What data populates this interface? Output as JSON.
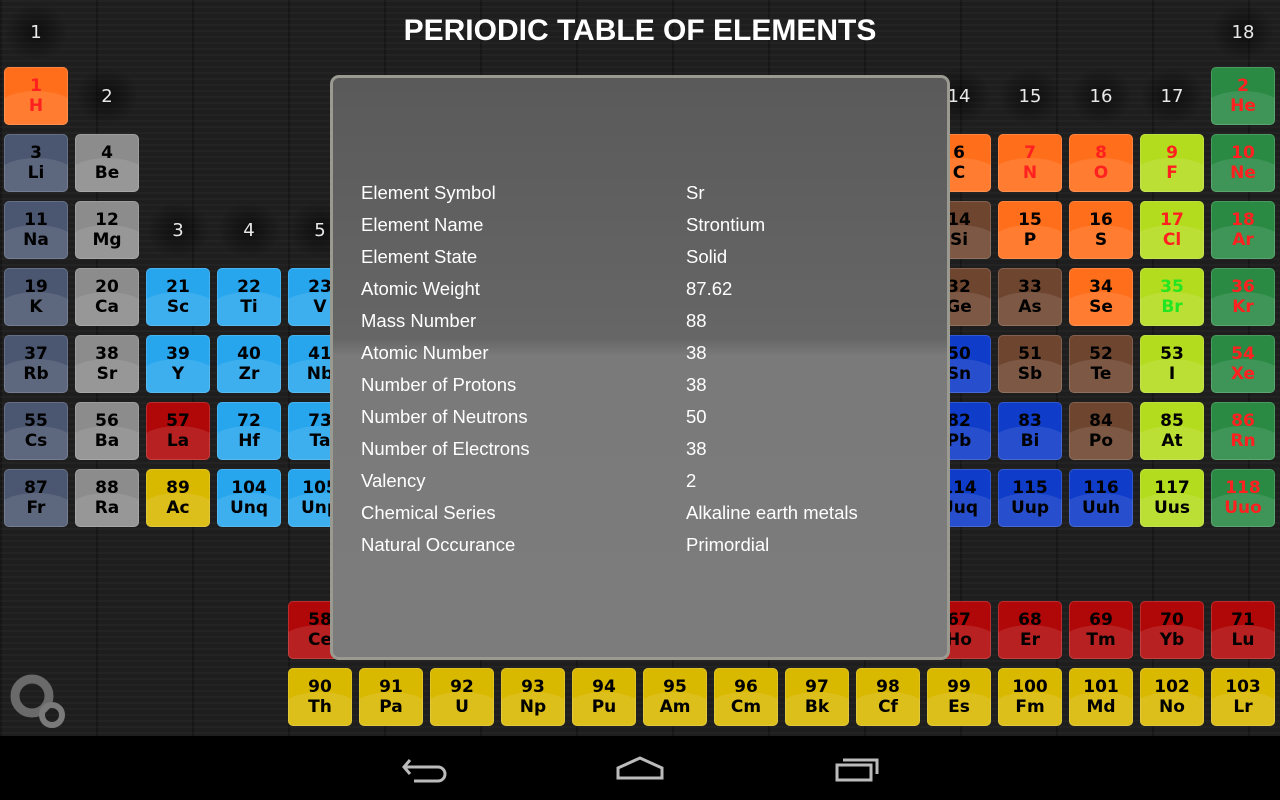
{
  "title": "PERIODIC TABLE OF ELEMENTS",
  "colors": {
    "hydrogen": "#ff6e1a",
    "alkali": "#4b5670",
    "alkaline": "#8c8c8c",
    "transition": "#27a6ee",
    "lanthanide": "#b00808",
    "actinide": "#d9b800",
    "nonmetal": "#ff6e1a",
    "halogen": "#b4dc1e",
    "noble": "#2a8a44",
    "metalloid": "#6e4630",
    "poor": "#0f3cc8",
    "text_solid": "#000000",
    "text_gas": "#ff2020",
    "text_liquid": "#22e622"
  },
  "group_labels": {
    "top": [
      {
        "label": "1",
        "col": 1
      },
      {
        "label": "18",
        "col": 18
      }
    ],
    "row1": [
      {
        "label": "2",
        "col": 2
      },
      {
        "label": "14",
        "col": 14
      },
      {
        "label": "15",
        "col": 15
      },
      {
        "label": "16",
        "col": 16
      },
      {
        "label": "17",
        "col": 17
      }
    ],
    "row3": [
      {
        "label": "3",
        "col": 3
      },
      {
        "label": "4",
        "col": 4
      },
      {
        "label": "5",
        "col": 5
      }
    ]
  },
  "periods": [
    [
      {
        "col": 1,
        "n": "1",
        "s": "H",
        "cat": "hydrogen",
        "st": "gas"
      },
      {
        "col": 18,
        "n": "2",
        "s": "He",
        "cat": "noble",
        "st": "gas"
      }
    ],
    [
      {
        "col": 1,
        "n": "3",
        "s": "Li",
        "cat": "alkali"
      },
      {
        "col": 2,
        "n": "4",
        "s": "Be",
        "cat": "alkaline"
      },
      {
        "col": 14,
        "n": "6",
        "s": "C",
        "cat": "nonmetal"
      },
      {
        "col": 15,
        "n": "7",
        "s": "N",
        "cat": "nonmetal",
        "st": "gas"
      },
      {
        "col": 16,
        "n": "8",
        "s": "O",
        "cat": "nonmetal",
        "st": "gas"
      },
      {
        "col": 17,
        "n": "9",
        "s": "F",
        "cat": "halogen",
        "st": "gas"
      },
      {
        "col": 18,
        "n": "10",
        "s": "Ne",
        "cat": "noble",
        "st": "gas"
      }
    ],
    [
      {
        "col": 1,
        "n": "11",
        "s": "Na",
        "cat": "alkali"
      },
      {
        "col": 2,
        "n": "12",
        "s": "Mg",
        "cat": "alkaline"
      },
      {
        "col": 14,
        "n": "14",
        "s": "Si",
        "cat": "metalloid"
      },
      {
        "col": 15,
        "n": "15",
        "s": "P",
        "cat": "nonmetal"
      },
      {
        "col": 16,
        "n": "16",
        "s": "S",
        "cat": "nonmetal"
      },
      {
        "col": 17,
        "n": "17",
        "s": "Cl",
        "cat": "halogen",
        "st": "gas"
      },
      {
        "col": 18,
        "n": "18",
        "s": "Ar",
        "cat": "noble",
        "st": "gas"
      }
    ],
    [
      {
        "col": 1,
        "n": "19",
        "s": "K",
        "cat": "alkali"
      },
      {
        "col": 2,
        "n": "20",
        "s": "Ca",
        "cat": "alkaline"
      },
      {
        "col": 3,
        "n": "21",
        "s": "Sc",
        "cat": "transition"
      },
      {
        "col": 4,
        "n": "22",
        "s": "Ti",
        "cat": "transition"
      },
      {
        "col": 5,
        "n": "23",
        "s": "V",
        "cat": "transition"
      },
      {
        "col": 14,
        "n": "32",
        "s": "Ge",
        "cat": "metalloid"
      },
      {
        "col": 15,
        "n": "33",
        "s": "As",
        "cat": "metalloid"
      },
      {
        "col": 16,
        "n": "34",
        "s": "Se",
        "cat": "nonmetal"
      },
      {
        "col": 17,
        "n": "35",
        "s": "Br",
        "cat": "halogen",
        "st": "liquid"
      },
      {
        "col": 18,
        "n": "36",
        "s": "Kr",
        "cat": "noble",
        "st": "gas"
      }
    ],
    [
      {
        "col": 1,
        "n": "37",
        "s": "Rb",
        "cat": "alkali"
      },
      {
        "col": 2,
        "n": "38",
        "s": "Sr",
        "cat": "alkaline"
      },
      {
        "col": 3,
        "n": "39",
        "s": "Y",
        "cat": "transition"
      },
      {
        "col": 4,
        "n": "40",
        "s": "Zr",
        "cat": "transition"
      },
      {
        "col": 5,
        "n": "41",
        "s": "Nb",
        "cat": "transition"
      },
      {
        "col": 14,
        "n": "50",
        "s": "Sn",
        "cat": "poor"
      },
      {
        "col": 15,
        "n": "51",
        "s": "Sb",
        "cat": "metalloid"
      },
      {
        "col": 16,
        "n": "52",
        "s": "Te",
        "cat": "metalloid"
      },
      {
        "col": 17,
        "n": "53",
        "s": "I",
        "cat": "halogen"
      },
      {
        "col": 18,
        "n": "54",
        "s": "Xe",
        "cat": "noble",
        "st": "gas"
      }
    ],
    [
      {
        "col": 1,
        "n": "55",
        "s": "Cs",
        "cat": "alkali"
      },
      {
        "col": 2,
        "n": "56",
        "s": "Ba",
        "cat": "alkaline"
      },
      {
        "col": 3,
        "n": "57",
        "s": "La",
        "cat": "lanthanide"
      },
      {
        "col": 4,
        "n": "72",
        "s": "Hf",
        "cat": "transition"
      },
      {
        "col": 5,
        "n": "73",
        "s": "Ta",
        "cat": "transition"
      },
      {
        "col": 14,
        "n": "82",
        "s": "Pb",
        "cat": "poor"
      },
      {
        "col": 15,
        "n": "83",
        "s": "Bi",
        "cat": "poor"
      },
      {
        "col": 16,
        "n": "84",
        "s": "Po",
        "cat": "metalloid"
      },
      {
        "col": 17,
        "n": "85",
        "s": "At",
        "cat": "halogen"
      },
      {
        "col": 18,
        "n": "86",
        "s": "Rn",
        "cat": "noble",
        "st": "gas"
      }
    ],
    [
      {
        "col": 1,
        "n": "87",
        "s": "Fr",
        "cat": "alkali"
      },
      {
        "col": 2,
        "n": "88",
        "s": "Ra",
        "cat": "alkaline"
      },
      {
        "col": 3,
        "n": "89",
        "s": "Ac",
        "cat": "actinide"
      },
      {
        "col": 4,
        "n": "104",
        "s": "Unq",
        "cat": "transition"
      },
      {
        "col": 5,
        "n": "105",
        "s": "Unp",
        "cat": "transition"
      },
      {
        "col": 14,
        "n": "114",
        "s": "Uuq",
        "cat": "poor"
      },
      {
        "col": 15,
        "n": "115",
        "s": "Uup",
        "cat": "poor"
      },
      {
        "col": 16,
        "n": "116",
        "s": "Uuh",
        "cat": "poor"
      },
      {
        "col": 17,
        "n": "117",
        "s": "Uus",
        "cat": "halogen"
      },
      {
        "col": 18,
        "n": "118",
        "s": "Uuo",
        "cat": "noble",
        "st": "gas"
      }
    ]
  ],
  "lanthanides": [
    {
      "col": 5,
      "n": "58",
      "s": "Ce"
    },
    {
      "col": 14,
      "n": "67",
      "s": "Ho"
    },
    {
      "col": 15,
      "n": "68",
      "s": "Er"
    },
    {
      "col": 16,
      "n": "69",
      "s": "Tm"
    },
    {
      "col": 17,
      "n": "70",
      "s": "Yb"
    },
    {
      "col": 18,
      "n": "71",
      "s": "Lu"
    }
  ],
  "actinides": [
    {
      "col": 5,
      "n": "90",
      "s": "Th"
    },
    {
      "col": 6,
      "n": "91",
      "s": "Pa"
    },
    {
      "col": 7,
      "n": "92",
      "s": "U"
    },
    {
      "col": 8,
      "n": "93",
      "s": "Np"
    },
    {
      "col": 9,
      "n": "94",
      "s": "Pu"
    },
    {
      "col": 10,
      "n": "95",
      "s": "Am"
    },
    {
      "col": 11,
      "n": "96",
      "s": "Cm"
    },
    {
      "col": 12,
      "n": "97",
      "s": "Bk"
    },
    {
      "col": 13,
      "n": "98",
      "s": "Cf"
    },
    {
      "col": 14,
      "n": "99",
      "s": "Es"
    },
    {
      "col": 15,
      "n": "100",
      "s": "Fm"
    },
    {
      "col": 16,
      "n": "101",
      "s": "Md"
    },
    {
      "col": 17,
      "n": "102",
      "s": "No"
    },
    {
      "col": 18,
      "n": "103",
      "s": "Lr"
    }
  ],
  "details": {
    "rows": [
      {
        "label": "Element Symbol",
        "value": "Sr"
      },
      {
        "label": "Element Name",
        "value": "Strontium"
      },
      {
        "label": "Element State",
        "value": "Solid"
      },
      {
        "label": "Atomic Weight",
        "value": "87.62"
      },
      {
        "label": "Mass Number",
        "value": "88"
      },
      {
        "label": "Atomic Number",
        "value": "38"
      },
      {
        "label": "Number of Protons",
        "value": "38"
      },
      {
        "label": "Number of Neutrons",
        "value": "50"
      },
      {
        "label": "Number of Electrons",
        "value": "38"
      },
      {
        "label": "Valency",
        "value": "2"
      },
      {
        "label": "Chemical Series",
        "value": "Alkaline earth metals"
      },
      {
        "label": "Natural Occurance",
        "value": "Primordial"
      }
    ]
  },
  "icons": {
    "settings": "gears-icon",
    "back": "back-icon",
    "home": "home-icon",
    "recents": "recent-apps-icon"
  }
}
